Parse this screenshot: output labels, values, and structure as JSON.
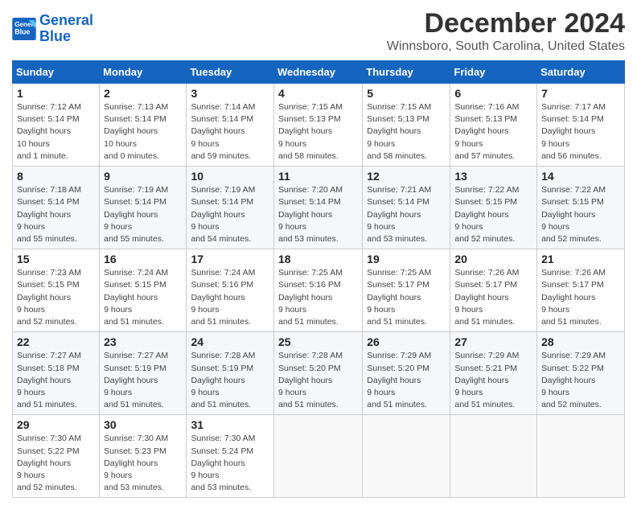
{
  "header": {
    "logo_line1": "General",
    "logo_line2": "Blue",
    "main_title": "December 2024",
    "subtitle": "Winnsboro, South Carolina, United States"
  },
  "calendar": {
    "days_of_week": [
      "Sunday",
      "Monday",
      "Tuesday",
      "Wednesday",
      "Thursday",
      "Friday",
      "Saturday"
    ],
    "weeks": [
      [
        null,
        {
          "day": "2",
          "sunrise": "7:13 AM",
          "sunset": "5:14 PM",
          "daylight": "10 hours and 0 minutes."
        },
        {
          "day": "3",
          "sunrise": "7:14 AM",
          "sunset": "5:14 PM",
          "daylight": "9 hours and 59 minutes."
        },
        {
          "day": "4",
          "sunrise": "7:15 AM",
          "sunset": "5:13 PM",
          "daylight": "9 hours and 58 minutes."
        },
        {
          "day": "5",
          "sunrise": "7:15 AM",
          "sunset": "5:13 PM",
          "daylight": "9 hours and 58 minutes."
        },
        {
          "day": "6",
          "sunrise": "7:16 AM",
          "sunset": "5:13 PM",
          "daylight": "9 hours and 57 minutes."
        },
        {
          "day": "7",
          "sunrise": "7:17 AM",
          "sunset": "5:14 PM",
          "daylight": "9 hours and 56 minutes."
        }
      ],
      [
        {
          "day": "1",
          "sunrise": "7:12 AM",
          "sunset": "5:14 PM",
          "daylight": "10 hours and 1 minute."
        },
        null,
        null,
        null,
        null,
        null,
        null
      ],
      [
        {
          "day": "8",
          "sunrise": "7:18 AM",
          "sunset": "5:14 PM",
          "daylight": "9 hours and 55 minutes."
        },
        {
          "day": "9",
          "sunrise": "7:19 AM",
          "sunset": "5:14 PM",
          "daylight": "9 hours and 55 minutes."
        },
        {
          "day": "10",
          "sunrise": "7:19 AM",
          "sunset": "5:14 PM",
          "daylight": "9 hours and 54 minutes."
        },
        {
          "day": "11",
          "sunrise": "7:20 AM",
          "sunset": "5:14 PM",
          "daylight": "9 hours and 53 minutes."
        },
        {
          "day": "12",
          "sunrise": "7:21 AM",
          "sunset": "5:14 PM",
          "daylight": "9 hours and 53 minutes."
        },
        {
          "day": "13",
          "sunrise": "7:22 AM",
          "sunset": "5:15 PM",
          "daylight": "9 hours and 52 minutes."
        },
        {
          "day": "14",
          "sunrise": "7:22 AM",
          "sunset": "5:15 PM",
          "daylight": "9 hours and 52 minutes."
        }
      ],
      [
        {
          "day": "15",
          "sunrise": "7:23 AM",
          "sunset": "5:15 PM",
          "daylight": "9 hours and 52 minutes."
        },
        {
          "day": "16",
          "sunrise": "7:24 AM",
          "sunset": "5:15 PM",
          "daylight": "9 hours and 51 minutes."
        },
        {
          "day": "17",
          "sunrise": "7:24 AM",
          "sunset": "5:16 PM",
          "daylight": "9 hours and 51 minutes."
        },
        {
          "day": "18",
          "sunrise": "7:25 AM",
          "sunset": "5:16 PM",
          "daylight": "9 hours and 51 minutes."
        },
        {
          "day": "19",
          "sunrise": "7:25 AM",
          "sunset": "5:17 PM",
          "daylight": "9 hours and 51 minutes."
        },
        {
          "day": "20",
          "sunrise": "7:26 AM",
          "sunset": "5:17 PM",
          "daylight": "9 hours and 51 minutes."
        },
        {
          "day": "21",
          "sunrise": "7:26 AM",
          "sunset": "5:17 PM",
          "daylight": "9 hours and 51 minutes."
        }
      ],
      [
        {
          "day": "22",
          "sunrise": "7:27 AM",
          "sunset": "5:18 PM",
          "daylight": "9 hours and 51 minutes."
        },
        {
          "day": "23",
          "sunrise": "7:27 AM",
          "sunset": "5:19 PM",
          "daylight": "9 hours and 51 minutes."
        },
        {
          "day": "24",
          "sunrise": "7:28 AM",
          "sunset": "5:19 PM",
          "daylight": "9 hours and 51 minutes."
        },
        {
          "day": "25",
          "sunrise": "7:28 AM",
          "sunset": "5:20 PM",
          "daylight": "9 hours and 51 minutes."
        },
        {
          "day": "26",
          "sunrise": "7:29 AM",
          "sunset": "5:20 PM",
          "daylight": "9 hours and 51 minutes."
        },
        {
          "day": "27",
          "sunrise": "7:29 AM",
          "sunset": "5:21 PM",
          "daylight": "9 hours and 51 minutes."
        },
        {
          "day": "28",
          "sunrise": "7:29 AM",
          "sunset": "5:22 PM",
          "daylight": "9 hours and 52 minutes."
        }
      ],
      [
        {
          "day": "29",
          "sunrise": "7:30 AM",
          "sunset": "5:22 PM",
          "daylight": "9 hours and 52 minutes."
        },
        {
          "day": "30",
          "sunrise": "7:30 AM",
          "sunset": "5:23 PM",
          "daylight": "9 hours and 53 minutes."
        },
        {
          "day": "31",
          "sunrise": "7:30 AM",
          "sunset": "5:24 PM",
          "daylight": "9 hours and 53 minutes."
        },
        null,
        null,
        null,
        null
      ]
    ],
    "labels": {
      "sunrise": "Sunrise:",
      "sunset": "Sunset:",
      "daylight": "Daylight hours"
    }
  }
}
